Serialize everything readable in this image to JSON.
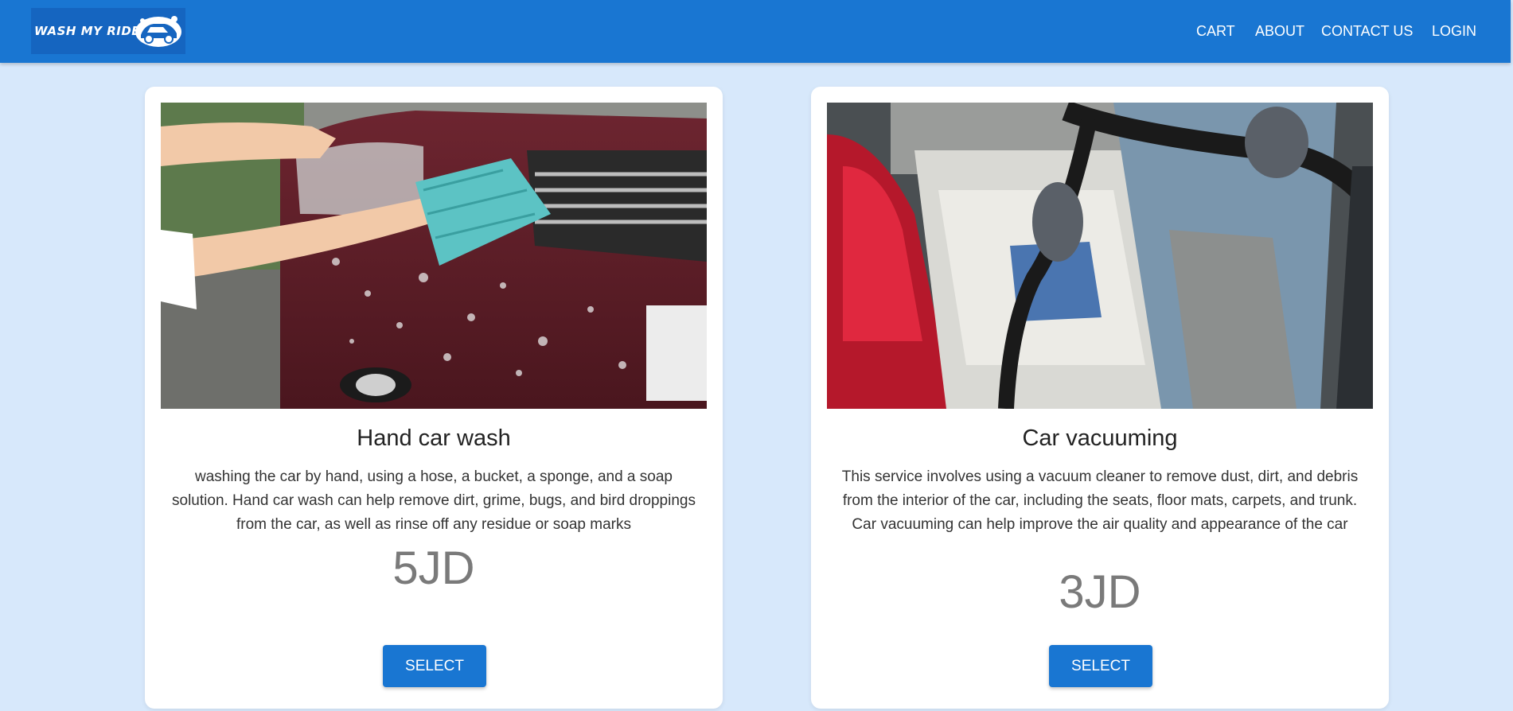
{
  "header": {
    "logo_text": "WASH MY RIDE",
    "nav": [
      {
        "label": "CART"
      },
      {
        "label": "ABOUT"
      },
      {
        "label": "CONTACT US"
      },
      {
        "label": "LOGIN"
      }
    ]
  },
  "services": [
    {
      "title": "Hand car wash",
      "description": "washing the car by hand, using a hose, a bucket, a sponge, and a soap solution. Hand car wash can help remove dirt, grime, bugs, and bird droppings from the car, as well as rinse off any residue or soap marks",
      "price": "5JD",
      "button_label": "SELECT",
      "image_icon": "car-wash-photo"
    },
    {
      "title": "Car vacuuming",
      "description": "This service involves using a vacuum cleaner to remove dust, dirt, and debris from the interior of the car, including the seats, floor mats, carpets, and trunk. Car vacuuming can help improve the air quality and appearance of the car",
      "price": "3JD",
      "button_label": "SELECT",
      "image_icon": "car-vacuum-photo"
    }
  ],
  "colors": {
    "primary": "#1976d2",
    "background": "#d7e8fb",
    "price": "#7a7a7a"
  }
}
